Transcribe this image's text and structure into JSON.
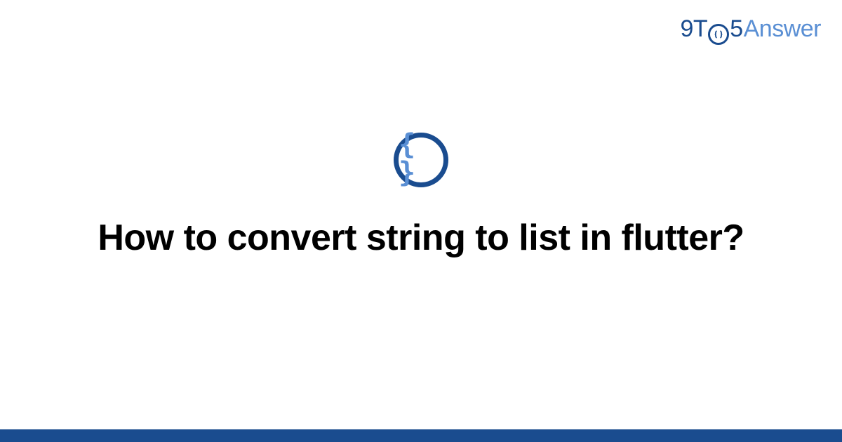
{
  "logo": {
    "part1": "9T",
    "part2": "5",
    "part3": "Answer"
  },
  "badge": {
    "symbol": "{ }"
  },
  "question": {
    "title": "How to convert string to list in flutter?"
  },
  "colors": {
    "primary": "#1a4c8f",
    "secondary": "#5a8fd4"
  }
}
